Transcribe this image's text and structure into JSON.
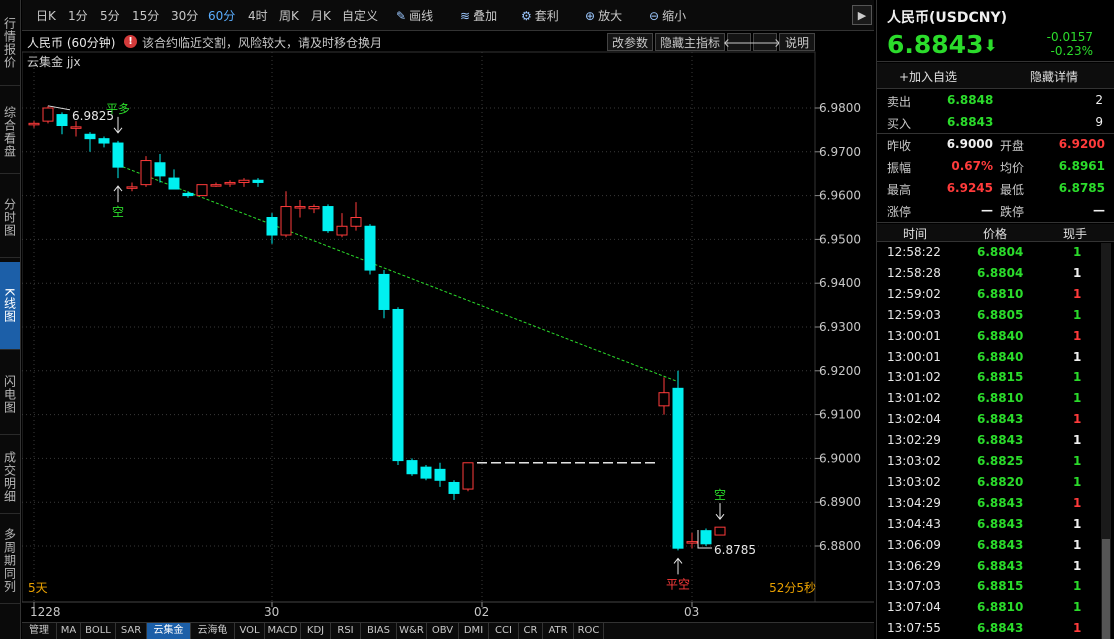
{
  "left_tabs": [
    "行情报价",
    "综合看盘",
    "分时图",
    "K线图",
    "闪电图",
    "成交明细",
    "多周期同列"
  ],
  "active_left_tab": 3,
  "toolbar": {
    "periods": [
      "日K",
      "1分",
      "5分",
      "15分",
      "30分",
      "60分",
      "4时",
      "周K",
      "月K",
      "自定义"
    ],
    "active_period": 5,
    "tools": [
      "画线",
      "叠加",
      "套利",
      "放大",
      "缩小"
    ]
  },
  "info": {
    "instrument": "人民币 (60分钟)",
    "warning": "该合约临近交割，风险较大，请及时移仓换月",
    "buttons": [
      "改参数",
      "隐藏主指标",
      "说明"
    ]
  },
  "indicator_label": "云集金 jjx",
  "chart_data": {
    "type": "candlestick",
    "ylim": [
      6.87,
      6.985
    ],
    "y_ticks": [
      "6.9800",
      "6.9700",
      "6.9600",
      "6.9500",
      "6.9400",
      "6.9300",
      "6.9200",
      "6.9100",
      "6.9000",
      "6.8900",
      "6.8800"
    ],
    "x_tick_labels": [
      {
        "label": "1228",
        "index": 0
      },
      {
        "label": "30",
        "index": 17
      },
      {
        "label": "02",
        "index": 32
      },
      {
        "label": "03",
        "index": 47
      }
    ],
    "candles": [
      {
        "o": 6.9765,
        "h": 6.977,
        "l": 6.9755,
        "c": 6.9765
      },
      {
        "o": 6.977,
        "h": 6.9805,
        "l": 6.9765,
        "c": 6.98
      },
      {
        "o": 6.9785,
        "h": 6.979,
        "l": 6.974,
        "c": 6.976
      },
      {
        "o": 6.9757,
        "h": 6.977,
        "l": 6.9735,
        "c": 6.9757
      },
      {
        "o": 6.974,
        "h": 6.9745,
        "l": 6.97,
        "c": 6.973
      },
      {
        "o": 6.973,
        "h": 6.9735,
        "l": 6.971,
        "c": 6.972
      },
      {
        "o": 6.972,
        "h": 6.9725,
        "l": 6.964,
        "c": 6.9665
      },
      {
        "o": 6.962,
        "h": 6.963,
        "l": 6.961,
        "c": 6.962
      },
      {
        "o": 6.9625,
        "h": 6.969,
        "l": 6.962,
        "c": 6.968
      },
      {
        "o": 6.9675,
        "h": 6.9695,
        "l": 6.963,
        "c": 6.9645
      },
      {
        "o": 6.964,
        "h": 6.966,
        "l": 6.9615,
        "c": 6.9615
      },
      {
        "o": 6.9605,
        "h": 6.961,
        "l": 6.9595,
        "c": 6.96
      },
      {
        "o": 6.96,
        "h": 6.9625,
        "l": 6.96,
        "c": 6.9625
      },
      {
        "o": 6.9625,
        "h": 6.963,
        "l": 6.962,
        "c": 6.9625
      },
      {
        "o": 6.9628,
        "h": 6.9635,
        "l": 6.962,
        "c": 6.963
      },
      {
        "o": 6.963,
        "h": 6.964,
        "l": 6.962,
        "c": 6.9635
      },
      {
        "o": 6.9635,
        "h": 6.964,
        "l": 6.962,
        "c": 6.963
      },
      {
        "o": 6.955,
        "h": 6.956,
        "l": 6.949,
        "c": 6.951
      },
      {
        "o": 6.951,
        "h": 6.961,
        "l": 6.9505,
        "c": 6.9575
      },
      {
        "o": 6.9575,
        "h": 6.959,
        "l": 6.955,
        "c": 6.9575
      },
      {
        "o": 6.957,
        "h": 6.958,
        "l": 6.956,
        "c": 6.9575
      },
      {
        "o": 6.9575,
        "h": 6.958,
        "l": 6.9515,
        "c": 6.952
      },
      {
        "o": 6.951,
        "h": 6.956,
        "l": 6.9505,
        "c": 6.953
      },
      {
        "o": 6.953,
        "h": 6.9585,
        "l": 6.952,
        "c": 6.955
      },
      {
        "o": 6.953,
        "h": 6.9535,
        "l": 6.942,
        "c": 6.943
      },
      {
        "o": 6.942,
        "h": 6.943,
        "l": 6.932,
        "c": 6.934
      },
      {
        "o": 6.934,
        "h": 6.9345,
        "l": 6.8985,
        "c": 6.8995
      },
      {
        "o": 6.8995,
        "h": 6.9,
        "l": 6.896,
        "c": 6.8965
      },
      {
        "o": 6.898,
        "h": 6.8985,
        "l": 6.895,
        "c": 6.8955
      },
      {
        "o": 6.8975,
        "h": 6.899,
        "l": 6.8935,
        "c": 6.895
      },
      {
        "o": 6.8945,
        "h": 6.895,
        "l": 6.8905,
        "c": 6.892
      },
      {
        "o": 6.893,
        "h": 6.899,
        "l": 6.8925,
        "c": 6.899
      },
      {
        "o": 6.899,
        "h": 6.899,
        "l": 6.899,
        "c": 6.899
      },
      {
        "o": 6.899,
        "h": 6.899,
        "l": 6.899,
        "c": 6.899
      },
      {
        "o": 6.899,
        "h": 6.899,
        "l": 6.899,
        "c": 6.899
      },
      {
        "o": 6.899,
        "h": 6.899,
        "l": 6.899,
        "c": 6.899
      },
      {
        "o": 6.899,
        "h": 6.899,
        "l": 6.899,
        "c": 6.899
      },
      {
        "o": 6.899,
        "h": 6.899,
        "l": 6.899,
        "c": 6.899
      },
      {
        "o": 6.899,
        "h": 6.899,
        "l": 6.899,
        "c": 6.899
      },
      {
        "o": 6.899,
        "h": 6.899,
        "l": 6.899,
        "c": 6.899
      },
      {
        "o": 6.899,
        "h": 6.899,
        "l": 6.899,
        "c": 6.899
      },
      {
        "o": 6.899,
        "h": 6.899,
        "l": 6.899,
        "c": 6.899
      },
      {
        "o": 6.899,
        "h": 6.899,
        "l": 6.899,
        "c": 6.899
      },
      {
        "o": 6.899,
        "h": 6.899,
        "l": 6.899,
        "c": 6.899
      },
      {
        "o": 6.899,
        "h": 6.899,
        "l": 6.899,
        "c": 6.899
      },
      {
        "o": 6.912,
        "h": 6.9185,
        "l": 6.91,
        "c": 6.915
      },
      {
        "o": 6.916,
        "h": 6.92,
        "l": 6.879,
        "c": 6.8795
      },
      {
        "o": 6.881,
        "h": 6.883,
        "l": 6.8795,
        "c": 6.881
      },
      {
        "o": 6.8835,
        "h": 6.884,
        "l": 6.88,
        "c": 6.8805
      },
      {
        "o": 6.8825,
        "h": 6.8843,
        "l": 6.8825,
        "c": 6.8843
      }
    ],
    "trendline": {
      "from": {
        "index": 6,
        "value": 6.967
      },
      "to": {
        "index": 46,
        "value": 6.9175
      }
    },
    "annotations": [
      {
        "text": "平多",
        "index": 6,
        "side": "above",
        "color": "#2bdc2b"
      },
      {
        "text": "空",
        "index": 6,
        "side": "below",
        "color": "#2bdc2b"
      },
      {
        "text": "平空",
        "index": 46,
        "side": "below",
        "color": "#ff3b3b"
      },
      {
        "text": "空",
        "index": 49,
        "side": "above",
        "color": "#2bdc2b"
      }
    ],
    "high_label": {
      "text": "6.9825",
      "index": 1
    },
    "low_label": {
      "text": "6.8785",
      "index": 48
    },
    "footer_left": "5天",
    "footer_right": "52分5秒",
    "colors": {
      "up": "#ff3b3b",
      "down": "#00f0f0",
      "trend": "#2bdc2b",
      "grid": "#3a3a3a",
      "axis_text": "#c8c8c8"
    }
  },
  "bottom_indicators": [
    "管理",
    "MA",
    "BOLL",
    "SAR",
    "云集金",
    "云海龟",
    "VOL",
    "MACD",
    "KDJ",
    "RSI",
    "BIAS",
    "W&R",
    "OBV",
    "DMI",
    "CCI",
    "CR",
    "ATR",
    "ROC"
  ],
  "active_indicator": 4,
  "quote": {
    "name": "人民币(USDCNY)",
    "price": "6.8843",
    "change": "-0.0157",
    "change_pct": "-0.23%",
    "add_watch": "+加入自选",
    "hide_detail": "隐藏详情",
    "sell_label": "卖出",
    "sell_price": "6.8848",
    "sell_qty": "2",
    "buy_label": "买入",
    "buy_price": "6.8843",
    "buy_qty": "9",
    "stats": [
      [
        {
          "label": "昨收",
          "value": "6.9000",
          "color": "white"
        },
        {
          "label": "开盘",
          "value": "6.9200",
          "color": "red"
        }
      ],
      [
        {
          "label": "振幅",
          "value": "0.67%",
          "color": "red"
        },
        {
          "label": "均价",
          "value": "6.8961",
          "color": "green"
        }
      ],
      [
        {
          "label": "最高",
          "value": "6.9245",
          "color": "red"
        },
        {
          "label": "最低",
          "value": "6.8785",
          "color": "green"
        }
      ],
      [
        {
          "label": "涨停",
          "value": "—",
          "color": "white"
        },
        {
          "label": "跌停",
          "value": "—",
          "color": "white"
        }
      ]
    ]
  },
  "trades": {
    "headers": [
      "时间",
      "价格",
      "现手"
    ],
    "rows": [
      {
        "time": "12:58:22",
        "price": "6.8804",
        "qty": "1",
        "qcolor": "green"
      },
      {
        "time": "12:58:28",
        "price": "6.8804",
        "qty": "1",
        "qcolor": "white"
      },
      {
        "time": "12:59:02",
        "price": "6.8810",
        "qty": "1",
        "qcolor": "red"
      },
      {
        "time": "12:59:03",
        "price": "6.8805",
        "qty": "1",
        "qcolor": "green"
      },
      {
        "time": "13:00:01",
        "price": "6.8840",
        "qty": "1",
        "qcolor": "red"
      },
      {
        "time": "13:00:01",
        "price": "6.8840",
        "qty": "1",
        "qcolor": "white"
      },
      {
        "time": "13:01:02",
        "price": "6.8815",
        "qty": "1",
        "qcolor": "green"
      },
      {
        "time": "13:01:02",
        "price": "6.8810",
        "qty": "1",
        "qcolor": "green"
      },
      {
        "time": "13:02:04",
        "price": "6.8843",
        "qty": "1",
        "qcolor": "red"
      },
      {
        "time": "13:02:29",
        "price": "6.8843",
        "qty": "1",
        "qcolor": "white"
      },
      {
        "time": "13:03:02",
        "price": "6.8825",
        "qty": "1",
        "qcolor": "green"
      },
      {
        "time": "13:03:02",
        "price": "6.8820",
        "qty": "1",
        "qcolor": "green"
      },
      {
        "time": "13:04:29",
        "price": "6.8843",
        "qty": "1",
        "qcolor": "red"
      },
      {
        "time": "13:04:43",
        "price": "6.8843",
        "qty": "1",
        "qcolor": "white"
      },
      {
        "time": "13:06:09",
        "price": "6.8843",
        "qty": "1",
        "qcolor": "white"
      },
      {
        "time": "13:06:29",
        "price": "6.8843",
        "qty": "1",
        "qcolor": "white"
      },
      {
        "time": "13:07:03",
        "price": "6.8815",
        "qty": "1",
        "qcolor": "green"
      },
      {
        "time": "13:07:04",
        "price": "6.8810",
        "qty": "1",
        "qcolor": "green"
      },
      {
        "time": "13:07:55",
        "price": "6.8843",
        "qty": "1",
        "qcolor": "red"
      }
    ]
  }
}
